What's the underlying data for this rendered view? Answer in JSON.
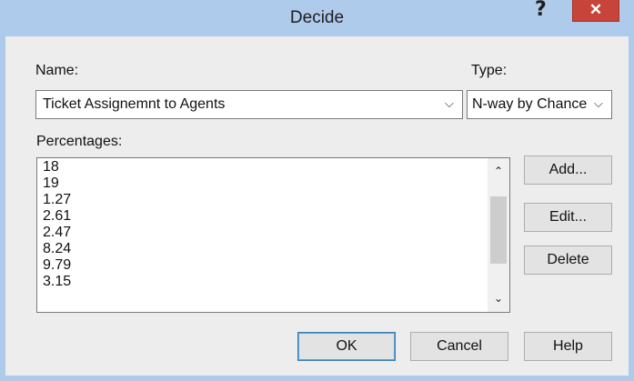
{
  "window": {
    "title": "Decide",
    "help_glyph": "?",
    "close_glyph": "✕"
  },
  "name_field": {
    "label": "Name:",
    "value": "Ticket Assignemnt to Agents",
    "arrow_icon": "chevron-down-icon"
  },
  "type_field": {
    "label": "Type:",
    "value": "N-way by Chance"
  },
  "percentages": {
    "label": "Percentages:",
    "items": [
      "18",
      "19",
      "1.27",
      "2.61",
      "2.47",
      "8.24",
      "9.79",
      "3.15"
    ]
  },
  "buttons": {
    "add": "Add...",
    "edit": "Edit...",
    "delete": "Delete",
    "ok": "OK",
    "cancel": "Cancel",
    "help": "Help"
  },
  "colors": {
    "titlebar": "#aecbeb",
    "close": "#c7443a",
    "dialog_bg": "#ededed"
  }
}
